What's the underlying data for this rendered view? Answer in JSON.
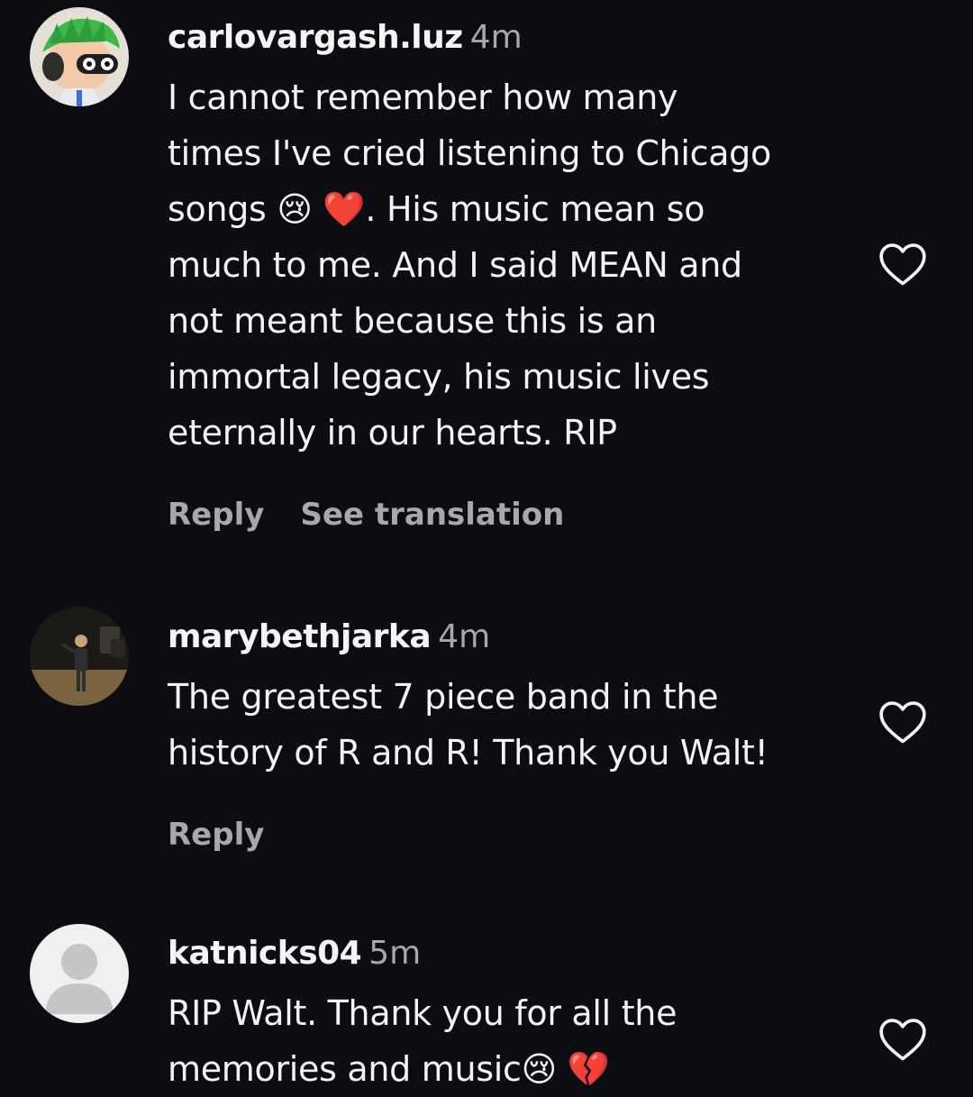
{
  "comments": [
    {
      "username": "carlovargash.luz",
      "time": "4m",
      "text": "I cannot remember how many\ntimes I've cried listening to Chicago\nsongs 😢 ❤️. His music mean so\nmuch to me. And I said MEAN and\nnot meant because this is an\nimmortal legacy, his music lives\neternally in our hearts. RIP",
      "reply_label": "Reply",
      "translation_label": "See translation"
    },
    {
      "username": "marybethjarka",
      "time": "4m",
      "text": "The greatest 7 piece band in the\nhistory of R and R! Thank you Walt!",
      "reply_label": "Reply"
    },
    {
      "username": "katnicks04",
      "time": "5m",
      "text": "RIP Walt. Thank you for all the\nmemories and music😢 💔"
    }
  ],
  "colors": {
    "background": "#0c0d12",
    "text": "#f2f3f5",
    "muted": "#a8a8a8"
  },
  "icons": {
    "like": "heart-outline-icon"
  }
}
